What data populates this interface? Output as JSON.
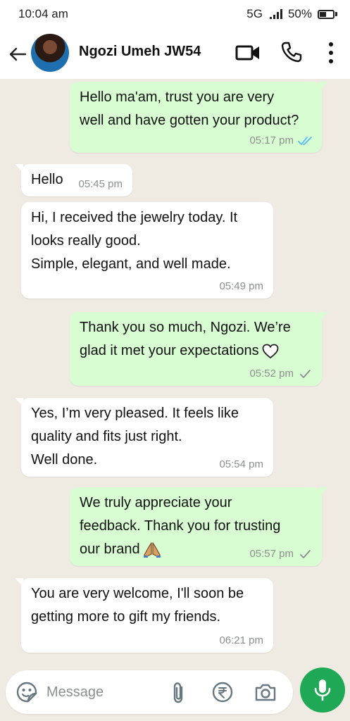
{
  "status_bar": {
    "time": "10:04 am",
    "network": "5G",
    "battery": "50%",
    "battery_level": 0.5
  },
  "header": {
    "contact_name": "Ngozi Umeh JW54",
    "icons": [
      "back-arrow-icon",
      "video-call-icon",
      "voice-call-icon",
      "more-options-icon"
    ]
  },
  "messages": [
    {
      "direction": "outgoing",
      "lines": [
        "Hello ma'am, trust you are very",
        "well and have gotten your product?"
      ],
      "time": "05:17 pm",
      "status": "read"
    },
    {
      "direction": "incoming",
      "lines": [
        "Hello"
      ],
      "time": "05:45 pm"
    },
    {
      "direction": "incoming",
      "lines": [
        "Hi, I received the jewelry today. It",
        "looks really good.",
        "Simple, elegant, and well made."
      ],
      "time": "05:49 pm"
    },
    {
      "direction": "outgoing",
      "lines": [
        "Thank you so much, Ngozi. We’re",
        "glad it met your expectations"
      ],
      "time": "05:52 pm",
      "status": "sent",
      "emoji": "white-heart"
    },
    {
      "direction": "incoming",
      "lines": [
        "Yes, I’m very pleased. It feels like",
        "quality and fits just right.",
        "Well done."
      ],
      "time": "05:54 pm"
    },
    {
      "direction": "outgoing",
      "lines": [
        "We truly appreciate your",
        "feedback. Thank you for trusting",
        "our brand"
      ],
      "time": "05:57 pm",
      "status": "sent",
      "emoji": "folded-hands"
    },
    {
      "direction": "incoming",
      "lines": [
        "You are very welcome, I'll soon be",
        "getting more to gift my friends."
      ],
      "time": "06:21 pm"
    }
  ],
  "composer": {
    "placeholder": "Message",
    "icons": [
      "sticker-icon",
      "attach-icon",
      "rupee-payment-icon",
      "camera-icon",
      "microphone-icon"
    ]
  },
  "colors": {
    "chat_background": "#efeae2",
    "outgoing_bubble": "#d9fdd3",
    "incoming_bubble": "#ffffff",
    "read_tick": "#53bdeb",
    "accent_green": "#1fa855"
  }
}
